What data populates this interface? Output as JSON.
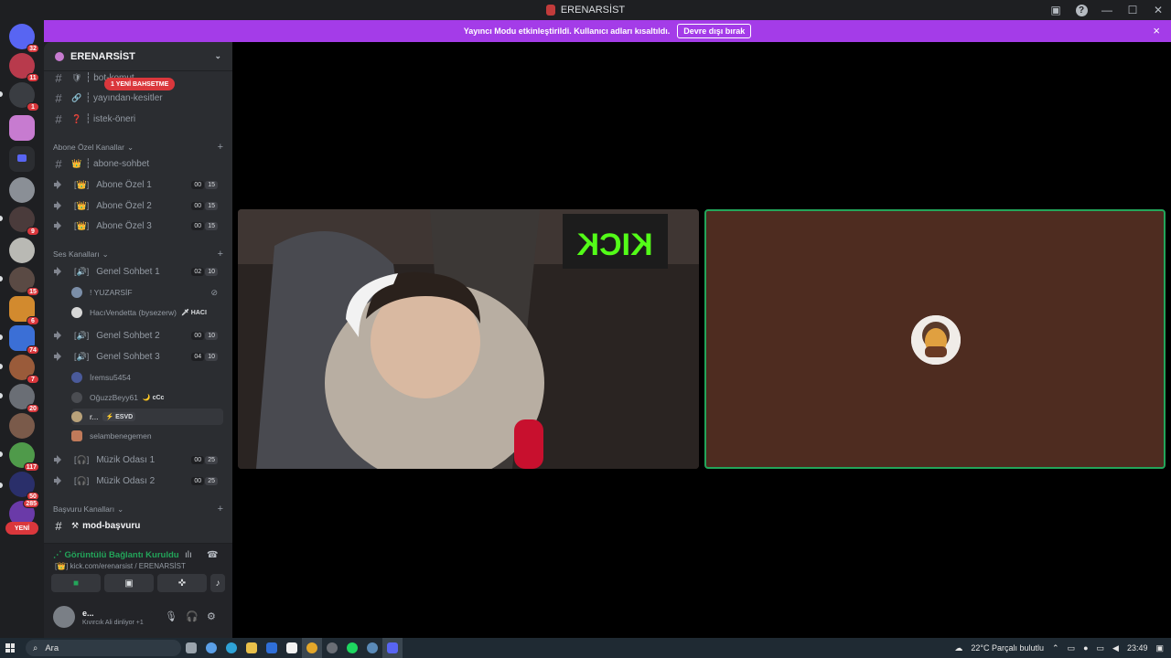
{
  "window": {
    "title": "ERENARSİST"
  },
  "notice": {
    "text": "Yayıncı Modu etkinleştirildi. Kullanıcı adları kısaltıldı.",
    "button": "Devre dışı bırak",
    "close": "×"
  },
  "rail": {
    "badges": [
      "32",
      "11",
      "1",
      "9",
      "15",
      "6",
      "74",
      "7",
      "20",
      "117",
      "50",
      "285"
    ],
    "new_label": "YENİ"
  },
  "sidebar": {
    "guild_name": "ERENARSİST",
    "mention_pill": "1 YENİ BAHSETME",
    "top_channels": [
      {
        "name": "┆ bot-komut",
        "emoji": "🛡"
      },
      {
        "name": "┆ yayından-kesitler",
        "emoji": "🔗"
      },
      {
        "name": "┆ istek-öneri",
        "emoji": "❓"
      }
    ],
    "cat_abone": "Abone Özel Kanallar",
    "abone_text": {
      "name": "┆ abone-sohbet",
      "emoji": "👑"
    },
    "abone_voice": [
      {
        "name": "Abone Özel 1",
        "pre": "[👑]",
        "a": "00",
        "b": "15"
      },
      {
        "name": "Abone Özel 2",
        "pre": "[👑]",
        "a": "00",
        "b": "15"
      },
      {
        "name": "Abone Özel 3",
        "pre": "[👑]",
        "a": "00",
        "b": "15"
      }
    ],
    "cat_ses": "Ses Kanalları",
    "genel1": {
      "name": "Genel Sohbet 1",
      "pre": "[🔊]",
      "a": "02",
      "b": "10"
    },
    "genel1_members": [
      {
        "name": "! YUZARSİF",
        "tag": ""
      },
      {
        "name": "HacıVendetta (bysezerw)",
        "tag": "🗡 HACI"
      }
    ],
    "genel2": {
      "name": "Genel Sohbet 2",
      "pre": "[🔊]",
      "a": "00",
      "b": "10"
    },
    "genel3": {
      "name": "Genel Sohbet 3",
      "pre": "[🔊]",
      "a": "04",
      "b": "10"
    },
    "genel3_members": [
      {
        "name": "İremsu5454",
        "tag": ""
      },
      {
        "name": "OğuzzBeyy61",
        "tag": "🌙 cCc"
      },
      {
        "name": "r...",
        "tag": "⚡ ESVD"
      },
      {
        "name": "selambenegemen",
        "tag": ""
      }
    ],
    "muzik1": {
      "name": "Müzik Odası 1",
      "pre": "[🎧]",
      "a": "00",
      "b": "25"
    },
    "muzik2": {
      "name": "Müzik Odası 2",
      "pre": "[🎧]",
      "a": "00",
      "b": "25"
    },
    "cat_basvuru": "Başvuru Kanalları",
    "basvuru": {
      "name": "mod-başvuru",
      "emoji": "⚒"
    },
    "plus": "+"
  },
  "voice": {
    "status": "Görüntülü Bağlantı Kuruldu",
    "sub": "[👑] kick.com/erenarsist / ERENARSİST"
  },
  "user": {
    "name": "e...",
    "status": "Kıvırcık Ali dinliyor +1"
  },
  "video": {
    "sign_text": "KICK"
  },
  "taskbar": {
    "search_placeholder": "Ara",
    "weather": "22°C  Parçalı bulutlu",
    "time": "23:49"
  },
  "colors": {
    "accent": "#a43ce8",
    "green": "#23a55a",
    "red": "#da373c",
    "sidebar": "#2b2d31"
  }
}
